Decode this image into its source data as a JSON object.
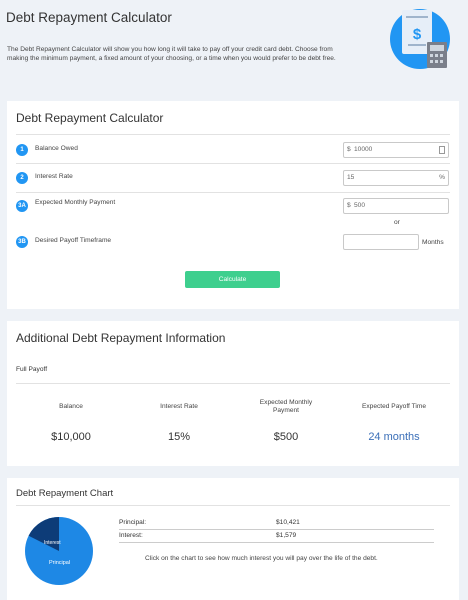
{
  "header": {
    "title": "Debt Repayment Calculator",
    "description": "The Debt Repayment Calculator will show you how long it will take to pay off your credit card debt. Choose from making the minimum payment, a fixed amount of your choosing, or a time when you would prefer to be debt free.",
    "hero_icon": "bill-calculator-icon",
    "dollar_sign": "$"
  },
  "calculator": {
    "title": "Debt Repayment Calculator",
    "rows": [
      {
        "step": "1",
        "label": "Balance Owed",
        "prefix": "$",
        "value": "10000",
        "suffix": ""
      },
      {
        "step": "2",
        "label": "Interest Rate",
        "prefix": "",
        "value": "15",
        "suffix": "%"
      },
      {
        "step": "3A",
        "label": "Expected Monthly Payment",
        "prefix": "$",
        "value": "500",
        "suffix": ""
      },
      {
        "step": "3B",
        "label": "Desired Payoff Timeframe",
        "prefix": "",
        "value": "",
        "suffix": ""
      }
    ],
    "or_text": "or",
    "months_label": "Months",
    "button_label": "Calculate"
  },
  "info": {
    "title": "Additional Debt Repayment Information",
    "subtitle": "Full Payoff",
    "columns": [
      {
        "header": "Balance",
        "value": "$10,000"
      },
      {
        "header": "Interest Rate",
        "value": "15%"
      },
      {
        "header": "Expected Monthly Payment",
        "value": "$500"
      },
      {
        "header": "Expected Payoff Time",
        "value": "24 months"
      }
    ]
  },
  "chart": {
    "title": "Debt Repayment Chart",
    "rows": [
      {
        "label": "Principal:",
        "value": "$10,421"
      },
      {
        "label": "Interest:",
        "value": "$1,579"
      }
    ],
    "note": "Click on the chart to see how much interest you will pay over the life of the debt.",
    "slice_labels": {
      "interest": "Interest",
      "principal": "Principal"
    },
    "colors": {
      "principal": "#1e88e5",
      "interest": "#0d3c78"
    }
  },
  "colors": {
    "accent": "#2196f3",
    "button": "#3ecf8e",
    "highlight": "#3b6fb8"
  }
}
